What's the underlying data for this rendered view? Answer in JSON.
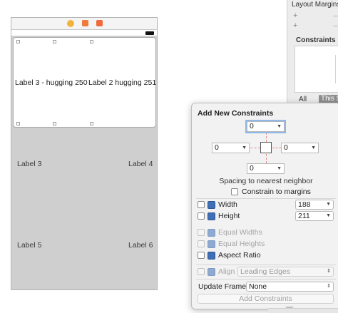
{
  "canvas": {
    "label_hugging_250": "Label 3 - hugging 250",
    "label_hugging_251": "Label 2 hugging 251",
    "label_3": "Label 3",
    "label_4": "Label 4",
    "label_5": "Label 5",
    "label_6": "Label 6"
  },
  "inspector": {
    "layout_margins": "Layout Margins",
    "plus_1": "+",
    "plus_2": "+",
    "constraints_title": "Constraints",
    "tab_all": "All",
    "tab_this": "This S"
  },
  "popover": {
    "title": "Add New Constraints",
    "top_value": "0",
    "left_value": "0",
    "right_value": "0",
    "bottom_value": "0",
    "spacing_label": "Spacing to nearest neighbor",
    "constrain_margins": "Constrain to margins",
    "width_label": "Width",
    "width_value": "188",
    "height_label": "Height",
    "height_value": "211",
    "equal_widths": "Equal Widths",
    "equal_heights": "Equal Heights",
    "aspect_ratio": "Aspect Ratio",
    "align_label": "Align",
    "align_value": "Leading Edges",
    "update_frames_label": "Update Frames",
    "update_frames_value": "None",
    "add_button": "Add Constraints"
  },
  "colors": {
    "accent": "#3f6fb5",
    "constraint_red": "#e08c8c",
    "canvas_gray": "#cfcfcf"
  }
}
